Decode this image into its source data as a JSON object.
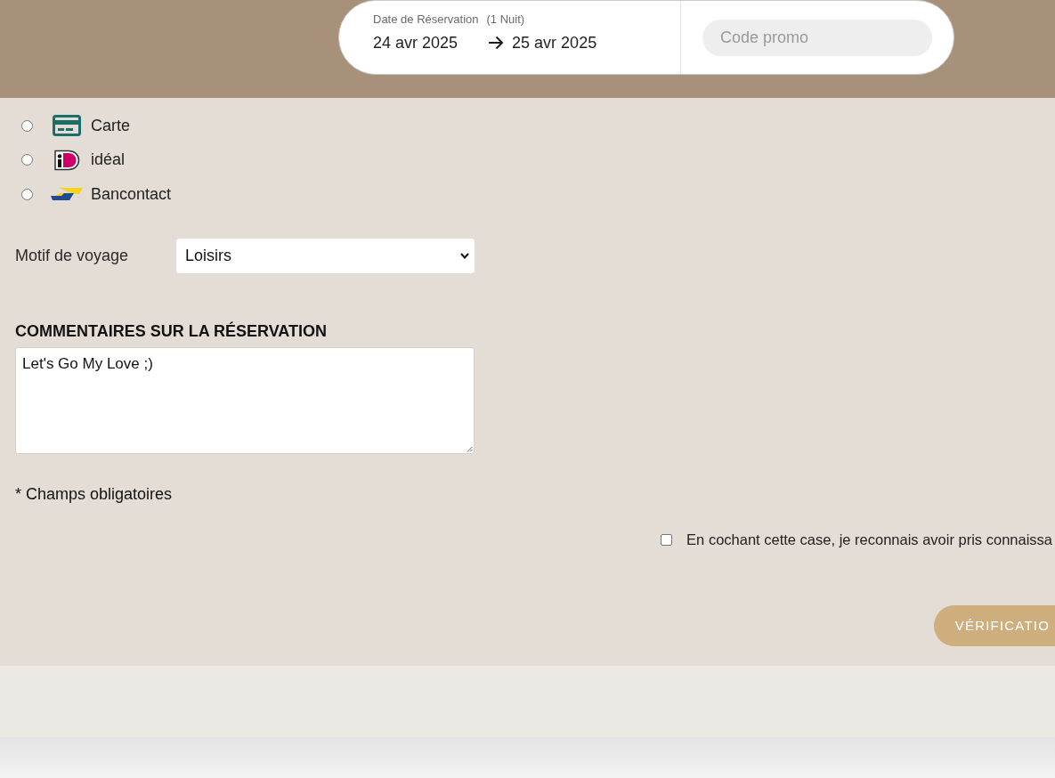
{
  "booking_bar": {
    "date_label": "Date de Réservation",
    "nights": "(1 Nuit)",
    "check_in": "24 avr 2025",
    "check_out": "25 avr 2025",
    "promo": {
      "placeholder": "Code promo"
    }
  },
  "payment_methods": [
    {
      "kind": "card",
      "label": "Carte",
      "selected": false
    },
    {
      "kind": "ideal",
      "label": "idéal",
      "selected": false
    },
    {
      "kind": "bancontact",
      "label": "Bancontact",
      "selected": false
    }
  ],
  "trip_purpose": {
    "label": "Motif de voyage",
    "value": "Loisirs"
  },
  "comments": {
    "heading": "COMMENTAIRES SUR LA RÉSERVATION",
    "value": "Let's Go My Love ;)"
  },
  "required_note": "* Champs obligatoires",
  "consent": {
    "label": "En cochant cette case, je reconnais avoir pris connaissa",
    "checked": false
  },
  "submit_button": "VÉRIFICATIO"
}
